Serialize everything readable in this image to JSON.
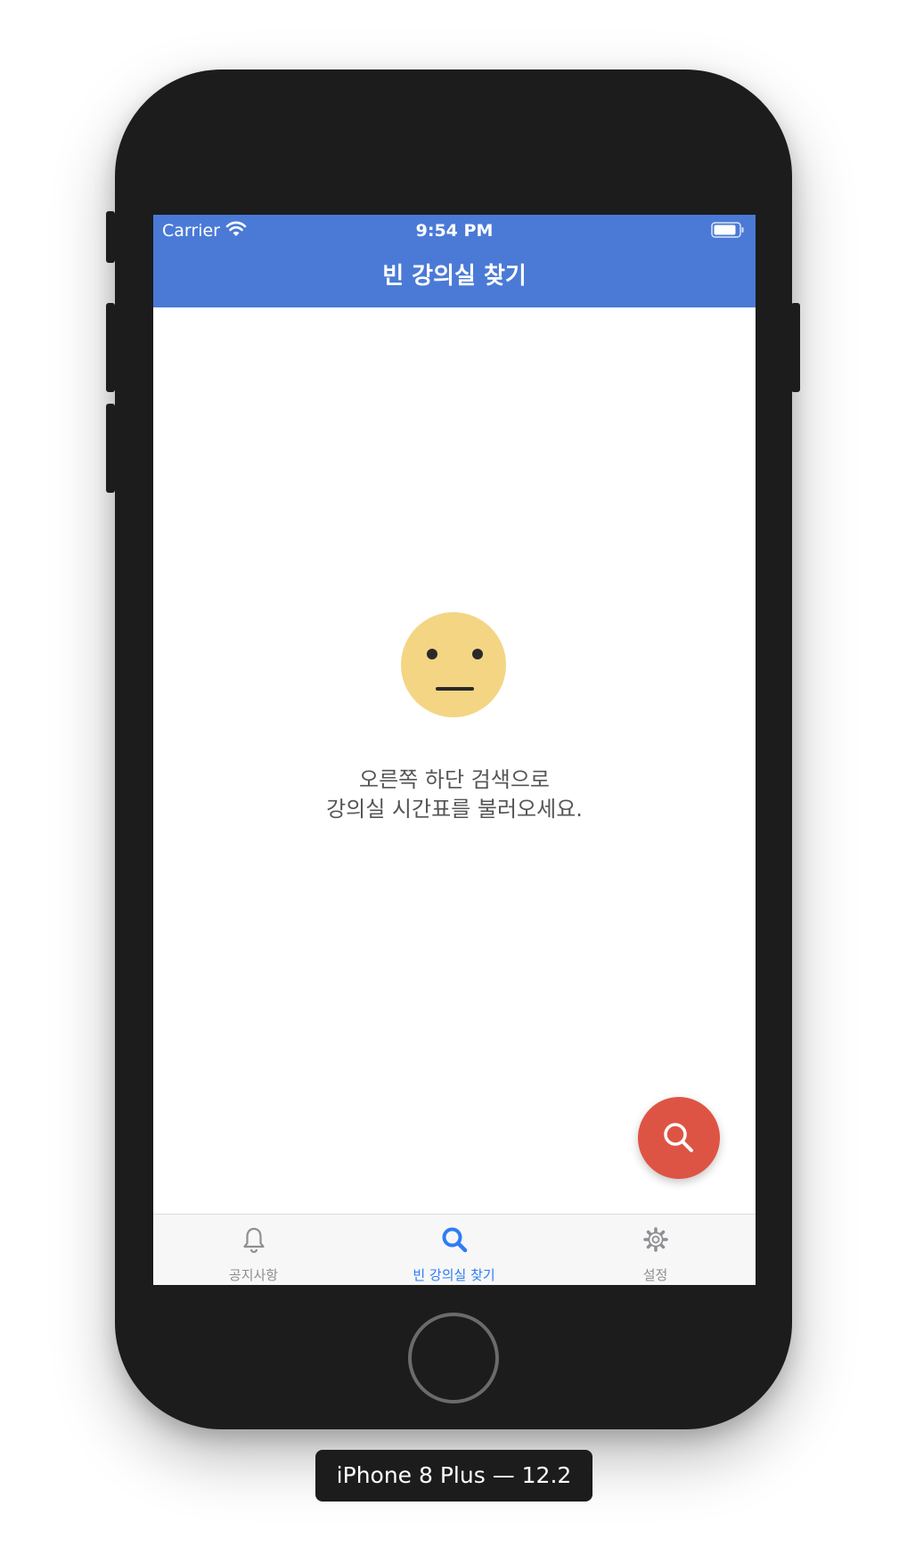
{
  "status_bar": {
    "carrier": "Carrier",
    "time": "9:54 PM"
  },
  "nav": {
    "title": "빈 강의실 찾기"
  },
  "empty_state": {
    "icon": "neutral-face-icon",
    "line1": "오른쪽 하단 검색으로",
    "line2": "강의실 시간표를 불러오세요."
  },
  "fab": {
    "icon": "search-icon",
    "color": "#de5444"
  },
  "tabs": [
    {
      "label": "공지사항",
      "icon": "bell-icon",
      "active": false
    },
    {
      "label": "빈 강의실 찾기",
      "icon": "search-icon",
      "active": true
    },
    {
      "label": "설정",
      "icon": "gear-icon",
      "active": false
    }
  ],
  "device_label": "iPhone 8 Plus — 12.2",
  "colors": {
    "nav_bar": "#4a7ad6",
    "fab": "#de5444",
    "tab_active": "#2f7cf5",
    "tab_inactive": "#8e8e93",
    "face": "#f3d584"
  }
}
